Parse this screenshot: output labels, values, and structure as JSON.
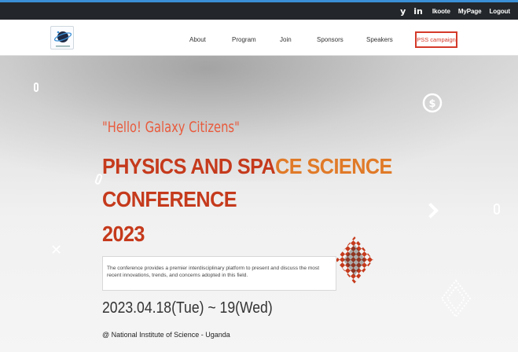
{
  "topbar": {
    "twitter_glyph": "y",
    "linkedin_glyph": "in",
    "user": "Ikoote",
    "mypage": "MyPage",
    "logout": "Logout"
  },
  "nav": {
    "items": [
      "About",
      "Program",
      "Join",
      "Sponsors",
      "Speakers"
    ],
    "cta": "PSS campaign"
  },
  "hero": {
    "tagline": "\"Hello! Galaxy Citizens\"",
    "title_line1_a": "PHYSICS AND SPA",
    "title_line1_b": "CE SCIENCE",
    "title_line2": "CONFERENCE",
    "title_line3": "2023",
    "description_line1": "The conference provides a premier interdisciplinary platform to present and discuss the most",
    "description_line2": "recent innovations, trends, and concerns adopted in this field.",
    "date": "2023.04.18(Tue) ~ 19(Wed)",
    "venue": "@ National Institute of Science - Uganda"
  },
  "colors": {
    "accent_red": "#c53a1c",
    "accent_orange": "#e07a28",
    "cta_border": "#d43a2a",
    "topbar_bg": "#23272b"
  },
  "icons": {
    "twitter": "twitter-icon",
    "linkedin": "linkedin-icon",
    "logo": "conference-logo",
    "dollar_badge": "dollar-circle-icon",
    "diamond_pattern": "diamond-pattern-icon"
  }
}
